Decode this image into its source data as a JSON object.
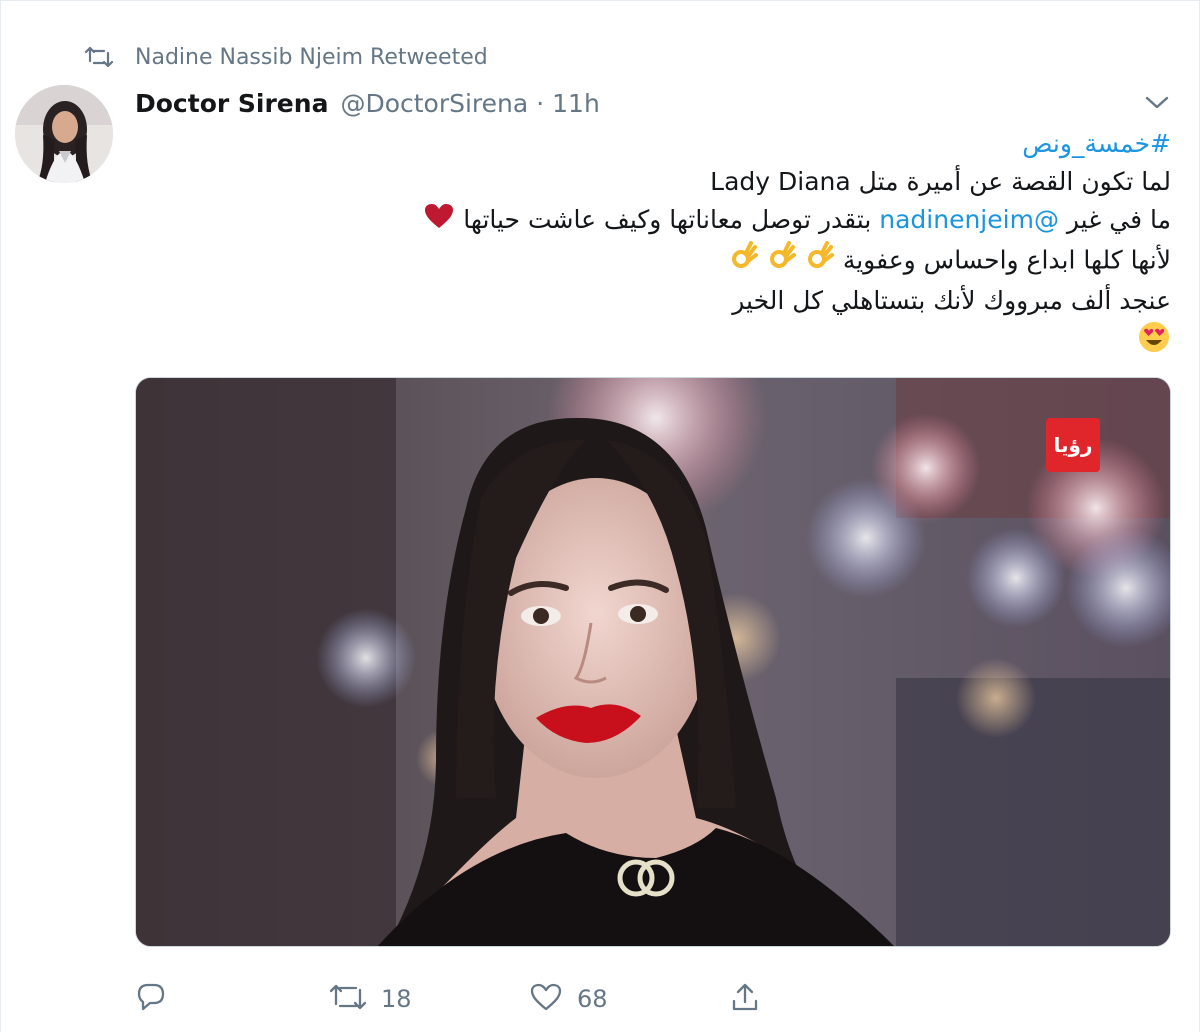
{
  "retweet_context": {
    "icon": "retweet-icon",
    "text": "Nadine Nassib Njeim Retweeted"
  },
  "tweet": {
    "author_name": "Doctor Sirena",
    "author_handle": "@DoctorSirena",
    "separator": "·",
    "time": "11h",
    "hashtag": "#خمسة_ونص",
    "line1": "لما تكون القصة عن أميرة متل Lady Diana",
    "line2_prefix": "ما في غير",
    "mention": "@nadinenjeim",
    "line2_suffix": "بتقدر توصل معاناتها وكيف عاشت حياتها",
    "line3": "لأنها كلها ابداع واحساس وعفوية",
    "line4": "عنجد ألف مبرووك لأنك بتستاهلي كل الخير",
    "media_logo_text": "رؤيا"
  },
  "actions": {
    "reply_count": "",
    "retweet_count": "18",
    "like_count": "68"
  },
  "colors": {
    "link": "#1b95e0",
    "secondary_text": "#657786",
    "heart_emoji": "#be1931"
  },
  "icons": [
    "retweet-icon",
    "chevron-down-icon",
    "reply-icon",
    "like-icon",
    "share-icon",
    "red-heart-emoji",
    "ok-hand-emoji",
    "heart-eyes-emoji"
  ]
}
